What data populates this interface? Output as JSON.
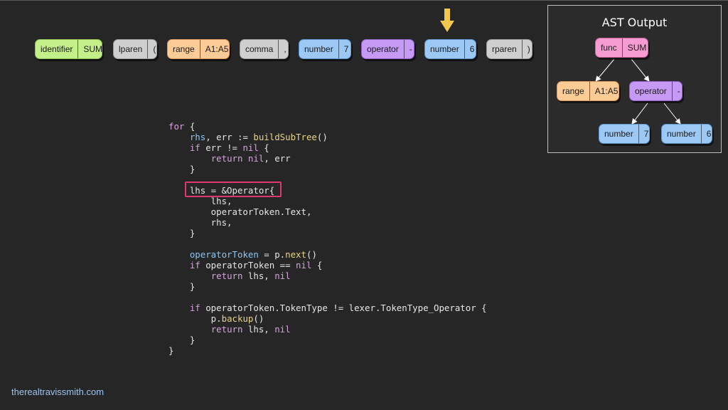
{
  "tokens": [
    {
      "type": "identifier",
      "value": "SUM",
      "color": "green"
    },
    {
      "type": "lparen",
      "value": "(",
      "color": "gray"
    },
    {
      "type": "range",
      "value": "A1:A5",
      "color": "orange"
    },
    {
      "type": "comma",
      "value": ",",
      "color": "gray"
    },
    {
      "type": "number",
      "value": "7",
      "color": "blue"
    },
    {
      "type": "operator",
      "value": "-",
      "color": "purple"
    },
    {
      "type": "number",
      "value": "6",
      "color": "blue"
    },
    {
      "type": "rparen",
      "value": ")",
      "color": "gray"
    }
  ],
  "current_token_arrow": {
    "icon": "down-arrow-icon",
    "color": "#f2c94c",
    "points_to_token_index": 6
  },
  "ast": {
    "title": "AST Output",
    "nodes": [
      {
        "type": "func",
        "value": "SUM",
        "color": "pink"
      },
      {
        "type": "range",
        "value": "A1:A5",
        "color": "orange"
      },
      {
        "type": "operator",
        "value": "-",
        "color": "purple"
      },
      {
        "type": "number",
        "value": "7",
        "color": "blue"
      },
      {
        "type": "number",
        "value": "6",
        "color": "blue"
      }
    ],
    "edges": [
      [
        0,
        1
      ],
      [
        0,
        2
      ],
      [
        2,
        3
      ],
      [
        2,
        4
      ]
    ]
  },
  "code": {
    "lines": [
      "for {",
      "    rhs, err := buildSubTree()",
      "    if err != nil {",
      "        return nil, err",
      "    }",
      "",
      "    lhs = &Operator{",
      "        lhs,",
      "        operatorToken.Text,",
      "        rhs,",
      "    }",
      "",
      "    operatorToken = p.next()",
      "    if operatorToken == nil {",
      "        return lhs, nil",
      "    }",
      "",
      "    if operatorToken.TokenType != lexer.TokenType_Operator {",
      "        p.backup()",
      "        return lhs, nil",
      "    }",
      "}"
    ],
    "highlighted_line": 6,
    "highlight_color": "#e0386d"
  },
  "colors": {
    "background": "#262626",
    "green": "#c4f08a",
    "gray": "#cfcfcf",
    "orange": "#fccb96",
    "blue": "#9cc8f6",
    "purple": "#c69af4",
    "pink": "#f79cd2"
  },
  "footer": "therealtravissmith.com"
}
